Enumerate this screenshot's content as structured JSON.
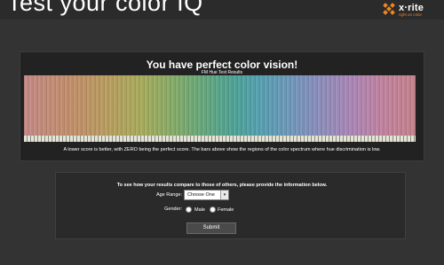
{
  "header": {
    "title": "Test your color IQ",
    "brand": "x·rite",
    "tagline": "right on color",
    "accent": "#f0861f"
  },
  "results": {
    "title": "You have perfect color vision!",
    "subtitle": "FM Hue Test Results",
    "explanation": "A lower score is better, with ZERO being the perfect score. The bars above show the regions of the color spectrum where hue discrimination is low."
  },
  "form": {
    "prompt": "To see how your results compare to those of others, please provide the information below.",
    "age_label": "Age Range:",
    "age_selected": "Choose One",
    "gender_label": "Gender:",
    "gender_options": [
      "Male",
      "Female"
    ],
    "submit_label": "Submit"
  }
}
